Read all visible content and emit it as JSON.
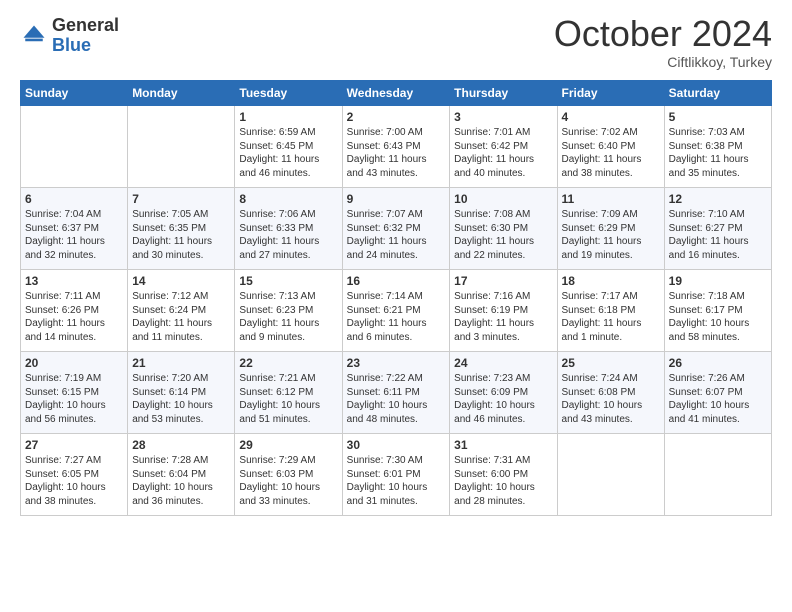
{
  "logo": {
    "general": "General",
    "blue": "Blue"
  },
  "header": {
    "month": "October 2024",
    "location": "Ciftlikkoy, Turkey"
  },
  "weekdays": [
    "Sunday",
    "Monday",
    "Tuesday",
    "Wednesday",
    "Thursday",
    "Friday",
    "Saturday"
  ],
  "weeks": [
    [
      {
        "day": "",
        "sunrise": "",
        "sunset": "",
        "daylight": ""
      },
      {
        "day": "",
        "sunrise": "",
        "sunset": "",
        "daylight": ""
      },
      {
        "day": "1",
        "sunrise": "Sunrise: 6:59 AM",
        "sunset": "Sunset: 6:45 PM",
        "daylight": "Daylight: 11 hours and 46 minutes."
      },
      {
        "day": "2",
        "sunrise": "Sunrise: 7:00 AM",
        "sunset": "Sunset: 6:43 PM",
        "daylight": "Daylight: 11 hours and 43 minutes."
      },
      {
        "day": "3",
        "sunrise": "Sunrise: 7:01 AM",
        "sunset": "Sunset: 6:42 PM",
        "daylight": "Daylight: 11 hours and 40 minutes."
      },
      {
        "day": "4",
        "sunrise": "Sunrise: 7:02 AM",
        "sunset": "Sunset: 6:40 PM",
        "daylight": "Daylight: 11 hours and 38 minutes."
      },
      {
        "day": "5",
        "sunrise": "Sunrise: 7:03 AM",
        "sunset": "Sunset: 6:38 PM",
        "daylight": "Daylight: 11 hours and 35 minutes."
      }
    ],
    [
      {
        "day": "6",
        "sunrise": "Sunrise: 7:04 AM",
        "sunset": "Sunset: 6:37 PM",
        "daylight": "Daylight: 11 hours and 32 minutes."
      },
      {
        "day": "7",
        "sunrise": "Sunrise: 7:05 AM",
        "sunset": "Sunset: 6:35 PM",
        "daylight": "Daylight: 11 hours and 30 minutes."
      },
      {
        "day": "8",
        "sunrise": "Sunrise: 7:06 AM",
        "sunset": "Sunset: 6:33 PM",
        "daylight": "Daylight: 11 hours and 27 minutes."
      },
      {
        "day": "9",
        "sunrise": "Sunrise: 7:07 AM",
        "sunset": "Sunset: 6:32 PM",
        "daylight": "Daylight: 11 hours and 24 minutes."
      },
      {
        "day": "10",
        "sunrise": "Sunrise: 7:08 AM",
        "sunset": "Sunset: 6:30 PM",
        "daylight": "Daylight: 11 hours and 22 minutes."
      },
      {
        "day": "11",
        "sunrise": "Sunrise: 7:09 AM",
        "sunset": "Sunset: 6:29 PM",
        "daylight": "Daylight: 11 hours and 19 minutes."
      },
      {
        "day": "12",
        "sunrise": "Sunrise: 7:10 AM",
        "sunset": "Sunset: 6:27 PM",
        "daylight": "Daylight: 11 hours and 16 minutes."
      }
    ],
    [
      {
        "day": "13",
        "sunrise": "Sunrise: 7:11 AM",
        "sunset": "Sunset: 6:26 PM",
        "daylight": "Daylight: 11 hours and 14 minutes."
      },
      {
        "day": "14",
        "sunrise": "Sunrise: 7:12 AM",
        "sunset": "Sunset: 6:24 PM",
        "daylight": "Daylight: 11 hours and 11 minutes."
      },
      {
        "day": "15",
        "sunrise": "Sunrise: 7:13 AM",
        "sunset": "Sunset: 6:23 PM",
        "daylight": "Daylight: 11 hours and 9 minutes."
      },
      {
        "day": "16",
        "sunrise": "Sunrise: 7:14 AM",
        "sunset": "Sunset: 6:21 PM",
        "daylight": "Daylight: 11 hours and 6 minutes."
      },
      {
        "day": "17",
        "sunrise": "Sunrise: 7:16 AM",
        "sunset": "Sunset: 6:19 PM",
        "daylight": "Daylight: 11 hours and 3 minutes."
      },
      {
        "day": "18",
        "sunrise": "Sunrise: 7:17 AM",
        "sunset": "Sunset: 6:18 PM",
        "daylight": "Daylight: 11 hours and 1 minute."
      },
      {
        "day": "19",
        "sunrise": "Sunrise: 7:18 AM",
        "sunset": "Sunset: 6:17 PM",
        "daylight": "Daylight: 10 hours and 58 minutes."
      }
    ],
    [
      {
        "day": "20",
        "sunrise": "Sunrise: 7:19 AM",
        "sunset": "Sunset: 6:15 PM",
        "daylight": "Daylight: 10 hours and 56 minutes."
      },
      {
        "day": "21",
        "sunrise": "Sunrise: 7:20 AM",
        "sunset": "Sunset: 6:14 PM",
        "daylight": "Daylight: 10 hours and 53 minutes."
      },
      {
        "day": "22",
        "sunrise": "Sunrise: 7:21 AM",
        "sunset": "Sunset: 6:12 PM",
        "daylight": "Daylight: 10 hours and 51 minutes."
      },
      {
        "day": "23",
        "sunrise": "Sunrise: 7:22 AM",
        "sunset": "Sunset: 6:11 PM",
        "daylight": "Daylight: 10 hours and 48 minutes."
      },
      {
        "day": "24",
        "sunrise": "Sunrise: 7:23 AM",
        "sunset": "Sunset: 6:09 PM",
        "daylight": "Daylight: 10 hours and 46 minutes."
      },
      {
        "day": "25",
        "sunrise": "Sunrise: 7:24 AM",
        "sunset": "Sunset: 6:08 PM",
        "daylight": "Daylight: 10 hours and 43 minutes."
      },
      {
        "day": "26",
        "sunrise": "Sunrise: 7:26 AM",
        "sunset": "Sunset: 6:07 PM",
        "daylight": "Daylight: 10 hours and 41 minutes."
      }
    ],
    [
      {
        "day": "27",
        "sunrise": "Sunrise: 7:27 AM",
        "sunset": "Sunset: 6:05 PM",
        "daylight": "Daylight: 10 hours and 38 minutes."
      },
      {
        "day": "28",
        "sunrise": "Sunrise: 7:28 AM",
        "sunset": "Sunset: 6:04 PM",
        "daylight": "Daylight: 10 hours and 36 minutes."
      },
      {
        "day": "29",
        "sunrise": "Sunrise: 7:29 AM",
        "sunset": "Sunset: 6:03 PM",
        "daylight": "Daylight: 10 hours and 33 minutes."
      },
      {
        "day": "30",
        "sunrise": "Sunrise: 7:30 AM",
        "sunset": "Sunset: 6:01 PM",
        "daylight": "Daylight: 10 hours and 31 minutes."
      },
      {
        "day": "31",
        "sunrise": "Sunrise: 7:31 AM",
        "sunset": "Sunset: 6:00 PM",
        "daylight": "Daylight: 10 hours and 28 minutes."
      },
      {
        "day": "",
        "sunrise": "",
        "sunset": "",
        "daylight": ""
      },
      {
        "day": "",
        "sunrise": "",
        "sunset": "",
        "daylight": ""
      }
    ]
  ]
}
